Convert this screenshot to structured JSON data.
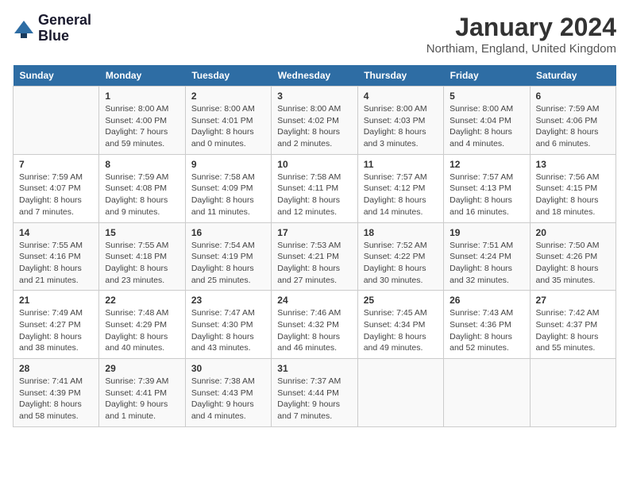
{
  "header": {
    "logo_line1": "General",
    "logo_line2": "Blue",
    "month_title": "January 2024",
    "location": "Northiam, England, United Kingdom"
  },
  "weekdays": [
    "Sunday",
    "Monday",
    "Tuesday",
    "Wednesday",
    "Thursday",
    "Friday",
    "Saturday"
  ],
  "weeks": [
    [
      {
        "day": "",
        "sunrise": "",
        "sunset": "",
        "daylight": ""
      },
      {
        "day": "1",
        "sunrise": "Sunrise: 8:00 AM",
        "sunset": "Sunset: 4:00 PM",
        "daylight": "Daylight: 7 hours and 59 minutes."
      },
      {
        "day": "2",
        "sunrise": "Sunrise: 8:00 AM",
        "sunset": "Sunset: 4:01 PM",
        "daylight": "Daylight: 8 hours and 0 minutes."
      },
      {
        "day": "3",
        "sunrise": "Sunrise: 8:00 AM",
        "sunset": "Sunset: 4:02 PM",
        "daylight": "Daylight: 8 hours and 2 minutes."
      },
      {
        "day": "4",
        "sunrise": "Sunrise: 8:00 AM",
        "sunset": "Sunset: 4:03 PM",
        "daylight": "Daylight: 8 hours and 3 minutes."
      },
      {
        "day": "5",
        "sunrise": "Sunrise: 8:00 AM",
        "sunset": "Sunset: 4:04 PM",
        "daylight": "Daylight: 8 hours and 4 minutes."
      },
      {
        "day": "6",
        "sunrise": "Sunrise: 7:59 AM",
        "sunset": "Sunset: 4:06 PM",
        "daylight": "Daylight: 8 hours and 6 minutes."
      }
    ],
    [
      {
        "day": "7",
        "sunrise": "Sunrise: 7:59 AM",
        "sunset": "Sunset: 4:07 PM",
        "daylight": "Daylight: 8 hours and 7 minutes."
      },
      {
        "day": "8",
        "sunrise": "Sunrise: 7:59 AM",
        "sunset": "Sunset: 4:08 PM",
        "daylight": "Daylight: 8 hours and 9 minutes."
      },
      {
        "day": "9",
        "sunrise": "Sunrise: 7:58 AM",
        "sunset": "Sunset: 4:09 PM",
        "daylight": "Daylight: 8 hours and 11 minutes."
      },
      {
        "day": "10",
        "sunrise": "Sunrise: 7:58 AM",
        "sunset": "Sunset: 4:11 PM",
        "daylight": "Daylight: 8 hours and 12 minutes."
      },
      {
        "day": "11",
        "sunrise": "Sunrise: 7:57 AM",
        "sunset": "Sunset: 4:12 PM",
        "daylight": "Daylight: 8 hours and 14 minutes."
      },
      {
        "day": "12",
        "sunrise": "Sunrise: 7:57 AM",
        "sunset": "Sunset: 4:13 PM",
        "daylight": "Daylight: 8 hours and 16 minutes."
      },
      {
        "day": "13",
        "sunrise": "Sunrise: 7:56 AM",
        "sunset": "Sunset: 4:15 PM",
        "daylight": "Daylight: 8 hours and 18 minutes."
      }
    ],
    [
      {
        "day": "14",
        "sunrise": "Sunrise: 7:55 AM",
        "sunset": "Sunset: 4:16 PM",
        "daylight": "Daylight: 8 hours and 21 minutes."
      },
      {
        "day": "15",
        "sunrise": "Sunrise: 7:55 AM",
        "sunset": "Sunset: 4:18 PM",
        "daylight": "Daylight: 8 hours and 23 minutes."
      },
      {
        "day": "16",
        "sunrise": "Sunrise: 7:54 AM",
        "sunset": "Sunset: 4:19 PM",
        "daylight": "Daylight: 8 hours and 25 minutes."
      },
      {
        "day": "17",
        "sunrise": "Sunrise: 7:53 AM",
        "sunset": "Sunset: 4:21 PM",
        "daylight": "Daylight: 8 hours and 27 minutes."
      },
      {
        "day": "18",
        "sunrise": "Sunrise: 7:52 AM",
        "sunset": "Sunset: 4:22 PM",
        "daylight": "Daylight: 8 hours and 30 minutes."
      },
      {
        "day": "19",
        "sunrise": "Sunrise: 7:51 AM",
        "sunset": "Sunset: 4:24 PM",
        "daylight": "Daylight: 8 hours and 32 minutes."
      },
      {
        "day": "20",
        "sunrise": "Sunrise: 7:50 AM",
        "sunset": "Sunset: 4:26 PM",
        "daylight": "Daylight: 8 hours and 35 minutes."
      }
    ],
    [
      {
        "day": "21",
        "sunrise": "Sunrise: 7:49 AM",
        "sunset": "Sunset: 4:27 PM",
        "daylight": "Daylight: 8 hours and 38 minutes."
      },
      {
        "day": "22",
        "sunrise": "Sunrise: 7:48 AM",
        "sunset": "Sunset: 4:29 PM",
        "daylight": "Daylight: 8 hours and 40 minutes."
      },
      {
        "day": "23",
        "sunrise": "Sunrise: 7:47 AM",
        "sunset": "Sunset: 4:30 PM",
        "daylight": "Daylight: 8 hours and 43 minutes."
      },
      {
        "day": "24",
        "sunrise": "Sunrise: 7:46 AM",
        "sunset": "Sunset: 4:32 PM",
        "daylight": "Daylight: 8 hours and 46 minutes."
      },
      {
        "day": "25",
        "sunrise": "Sunrise: 7:45 AM",
        "sunset": "Sunset: 4:34 PM",
        "daylight": "Daylight: 8 hours and 49 minutes."
      },
      {
        "day": "26",
        "sunrise": "Sunrise: 7:43 AM",
        "sunset": "Sunset: 4:36 PM",
        "daylight": "Daylight: 8 hours and 52 minutes."
      },
      {
        "day": "27",
        "sunrise": "Sunrise: 7:42 AM",
        "sunset": "Sunset: 4:37 PM",
        "daylight": "Daylight: 8 hours and 55 minutes."
      }
    ],
    [
      {
        "day": "28",
        "sunrise": "Sunrise: 7:41 AM",
        "sunset": "Sunset: 4:39 PM",
        "daylight": "Daylight: 8 hours and 58 minutes."
      },
      {
        "day": "29",
        "sunrise": "Sunrise: 7:39 AM",
        "sunset": "Sunset: 4:41 PM",
        "daylight": "Daylight: 9 hours and 1 minute."
      },
      {
        "day": "30",
        "sunrise": "Sunrise: 7:38 AM",
        "sunset": "Sunset: 4:43 PM",
        "daylight": "Daylight: 9 hours and 4 minutes."
      },
      {
        "day": "31",
        "sunrise": "Sunrise: 7:37 AM",
        "sunset": "Sunset: 4:44 PM",
        "daylight": "Daylight: 9 hours and 7 minutes."
      },
      {
        "day": "",
        "sunrise": "",
        "sunset": "",
        "daylight": ""
      },
      {
        "day": "",
        "sunrise": "",
        "sunset": "",
        "daylight": ""
      },
      {
        "day": "",
        "sunrise": "",
        "sunset": "",
        "daylight": ""
      }
    ]
  ]
}
